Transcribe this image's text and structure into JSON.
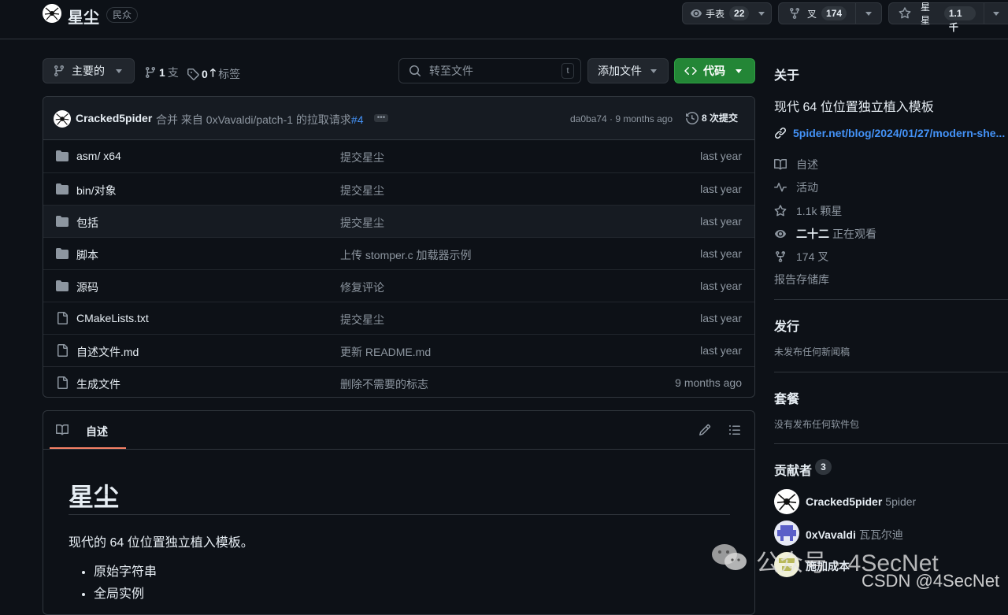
{
  "repo": {
    "name": "星尘",
    "visibility": "民众"
  },
  "header_actions": {
    "watch_label": "手表",
    "watch_count": "22",
    "fork_label": "叉",
    "fork_count": "174",
    "star_label": "星星",
    "star_count": "1.1千"
  },
  "toolbar": {
    "branch": "主要的",
    "branches_count": "1",
    "branches_label": "支",
    "tags_count": "0",
    "tags_label": "标签",
    "search_placeholder": "转至文件",
    "search_shortcut": "t",
    "add_file": "添加文件",
    "code": "代码"
  },
  "commit": {
    "author": "Cracked5pider",
    "message": "合并 来自 0xVavaldi/patch-1 的拉取请求",
    "pr": "#4",
    "hash_time": "da0ba74 · 9 months ago",
    "commits": "8 次提交"
  },
  "files": [
    {
      "type": "folder",
      "name": "asm/ x64",
      "message": "提交星尘",
      "time": "last year"
    },
    {
      "type": "folder",
      "name": "bin/对象",
      "message": "提交星尘",
      "time": "last year"
    },
    {
      "type": "folder",
      "name": "包括",
      "message": "提交星尘",
      "time": "last year"
    },
    {
      "type": "folder",
      "name": "脚本",
      "message": "上传 stomper.c 加载器示例",
      "time": "last year"
    },
    {
      "type": "folder",
      "name": "源码",
      "message": "修复评论",
      "time": "last year"
    },
    {
      "type": "file",
      "name": "CMakeLists.txt",
      "message": "提交星尘",
      "time": "last year"
    },
    {
      "type": "file",
      "name": "自述文件.md",
      "message": "更新 README.md",
      "time": "last year"
    },
    {
      "type": "file",
      "name": "生成文件",
      "message": "删除不需要的标志",
      "time": "9 months ago"
    }
  ],
  "readme": {
    "tab": "自述",
    "title": "星尘",
    "intro": "现代的 64 位位置独立植入模板。",
    "bullets": [
      "原始字符串",
      "全局实例"
    ]
  },
  "sidebar": {
    "about_title": "关于",
    "description": "现代 64 位位置独立植入模板",
    "link": "5pider.net/blog/2024/01/27/modern-she...",
    "readme": "自述",
    "activity": "活动",
    "stars": "1.1k 颗星",
    "watching_count": "二十二",
    "watching_label": "正在观看",
    "forks": "174 叉",
    "report": "报告存储库",
    "releases_title": "发行",
    "releases_text": "未发布任何新闻稿",
    "packages_title": "套餐",
    "packages_text": "没有发布任何软件包",
    "contributors_title": "贡献者",
    "contributors_count": "3",
    "contributors": [
      {
        "name": "Cracked5pider",
        "sub": "5pider"
      },
      {
        "name": "0xVavaldi",
        "sub": "瓦瓦尔迪"
      },
      {
        "name": "施加成本",
        "sub": ""
      }
    ]
  },
  "watermark": {
    "wechat": "公众号 · 4SecNet",
    "csdn": "CSDN @4SecNet"
  }
}
